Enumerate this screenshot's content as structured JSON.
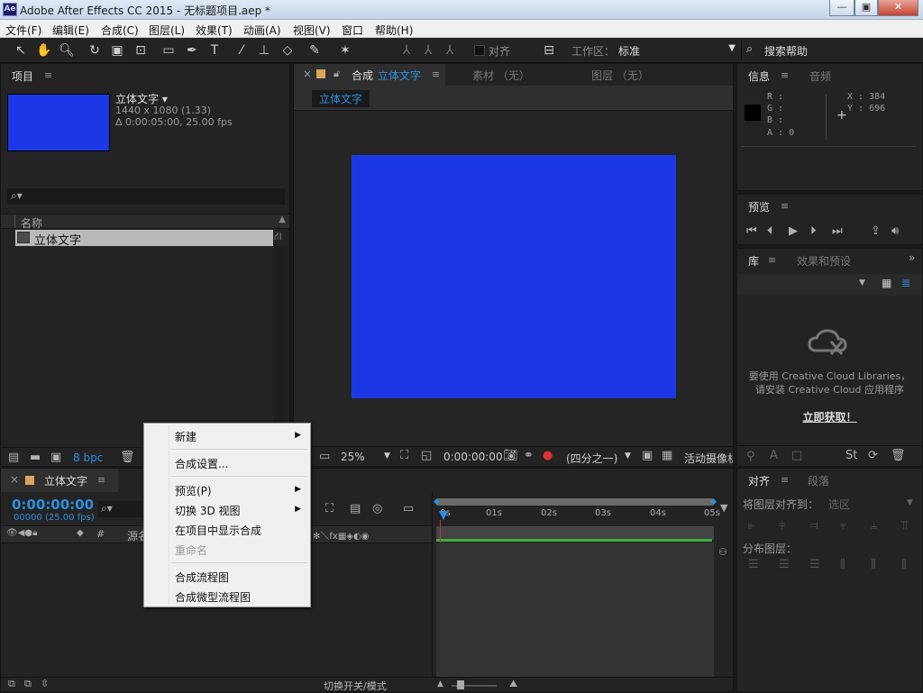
{
  "window": {
    "app_logo": "Ae",
    "title": "Adobe After Effects CC 2015 - 无标题项目.aep *",
    "buttons": {
      "minimize": "—",
      "maximize": "▣",
      "close": "✕"
    }
  },
  "menu": [
    "文件(F)",
    "编辑(E)",
    "合成(C)",
    "图层(L)",
    "效果(T)",
    "动画(A)",
    "视图(V)",
    "窗口",
    "帮助(H)"
  ],
  "toolbar": {
    "align_label": "对齐",
    "workspace_label": "工作区：",
    "workspace_value": "标准",
    "search_help": "搜索帮助"
  },
  "project": {
    "tab": "项目",
    "comp_name": "立体文字 ▾",
    "comp_size": "1440 x 1080 (1.33)",
    "comp_duration": "Δ 0:00:05:00, 25.00 fps",
    "search_icon": "⌕▾",
    "col_name": "名称",
    "item_name": "立体文字",
    "bpc": "8 bpc",
    "thumb_color": "#1c37e6"
  },
  "comp_viewer": {
    "tab_close": "×",
    "tab_label": "合成",
    "tab_name": "立体文字",
    "tab_footage": "素材 （无）",
    "tab_layer": "图层 （无）",
    "breadcrumb": "立体文字",
    "zoom": "25%",
    "timecode": "0:00:00:00",
    "resolution": "(四分之一)",
    "camera": "活动摄像机",
    "canvas_color": "#1c37e6"
  },
  "info": {
    "tab": "信息",
    "tab2": "音频",
    "r": "R :",
    "g": "G :",
    "b": "B :",
    "a": "A : 0",
    "x": "X : 384",
    "y": "Y : 696"
  },
  "preview": {
    "tab": "预览"
  },
  "library": {
    "tab": "库",
    "tab2": "效果和预设",
    "msg1": "要使用 Creative Cloud Libraries，",
    "msg2": "请安装 Creative Cloud 应用程序",
    "cta": "立即获取！"
  },
  "align": {
    "tab": "对齐",
    "tab2": "段落",
    "align_to": "将图层对齐到：",
    "align_to_value": "选区",
    "distribute": "分布图层："
  },
  "timeline": {
    "tab_close": "×",
    "tab": "立体文字",
    "timecode": "0:00:00:00",
    "fps": "00000 (25.00 fps)",
    "search_icon": "⌕▾",
    "col_source": "源名称",
    "ruler": [
      "0s",
      "01s",
      "02s",
      "03s",
      "04s",
      "05s"
    ],
    "footer": "切换开关/模式"
  },
  "context_menu": {
    "items": [
      {
        "label": "新建",
        "submenu": true,
        "enabled": true
      },
      {
        "label": "合成设置...",
        "submenu": false,
        "enabled": true
      },
      {
        "label": "预览(P)",
        "submenu": true,
        "enabled": true
      },
      {
        "label": "切换 3D 视图",
        "submenu": true,
        "enabled": true
      },
      {
        "label": "在项目中显示合成",
        "submenu": false,
        "enabled": true
      },
      {
        "label": "重命名",
        "submenu": false,
        "enabled": false
      },
      {
        "label": "合成流程图",
        "submenu": false,
        "enabled": true
      },
      {
        "label": "合成微型流程图",
        "submenu": false,
        "enabled": true
      }
    ]
  }
}
